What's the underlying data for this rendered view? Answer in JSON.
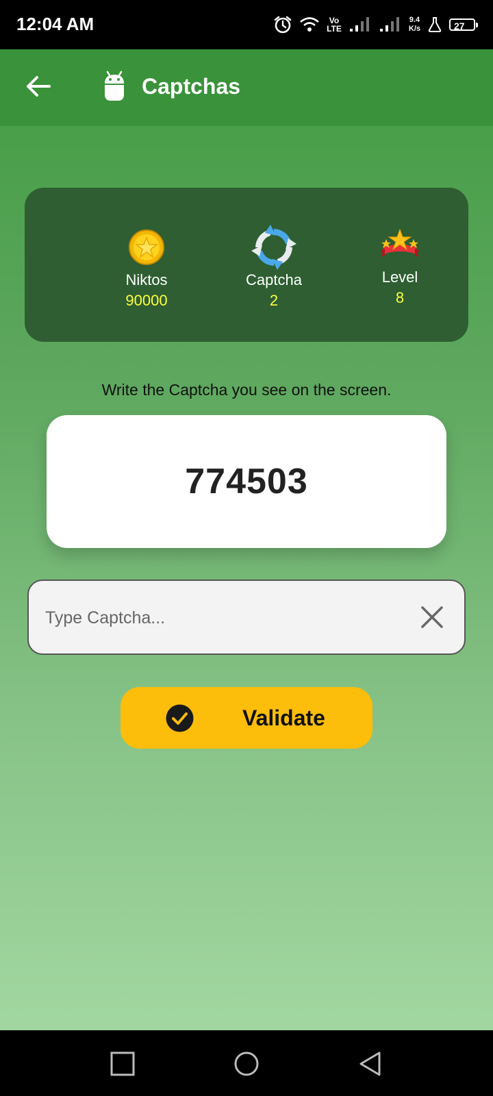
{
  "status_bar": {
    "time": "12:04 AM",
    "volte_top": "Vo",
    "volte_bottom": "LTE",
    "speed_value": "9.4",
    "speed_unit": "K/s",
    "battery": "27"
  },
  "app_bar": {
    "title": "Captchas",
    "back_icon": "arrow-left-icon",
    "app_icon": "android-icon"
  },
  "stats": {
    "niktos": {
      "label": "Niktos",
      "value": "90000",
      "icon": "gold-coin-star-icon"
    },
    "captcha": {
      "label": "Captcha",
      "value": "2",
      "icon": "refresh-arrows-icon"
    },
    "level": {
      "label": "Level",
      "value": "8",
      "icon": "stars-ribbon-icon"
    }
  },
  "instruction": "Write the Captcha you see on the screen.",
  "captcha_code": "774503",
  "input": {
    "placeholder": "Type Captcha...",
    "value": ""
  },
  "validate_button": {
    "label": "Validate"
  },
  "colors": {
    "app_bar": "#3a923a",
    "stats_card": "#2e5e31",
    "stat_value": "#ffff3a",
    "validate_button": "#fdbd0b"
  }
}
